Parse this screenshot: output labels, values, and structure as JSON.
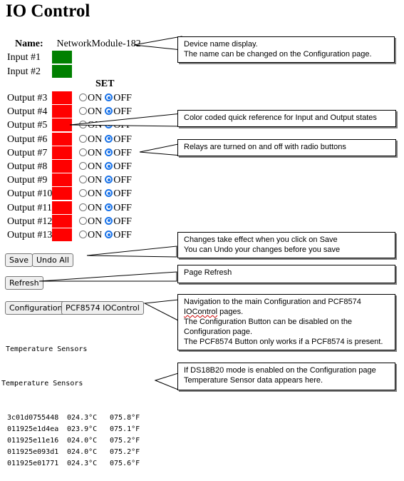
{
  "page": {
    "title": "IO Control"
  },
  "device": {
    "name_label": "Name:",
    "name_value": "NetworkModule-182"
  },
  "inputs": [
    {
      "label": "Input #1",
      "state": "on",
      "color": "#008000"
    },
    {
      "label": "Input #2",
      "state": "on",
      "color": "#008000"
    }
  ],
  "set_header": "SET",
  "radio_labels": {
    "on": "ON",
    "off": "OFF"
  },
  "outputs": [
    {
      "label": "Output #3",
      "state": "off",
      "color": "#ff0000",
      "selected": "OFF"
    },
    {
      "label": "Output #4",
      "state": "off",
      "color": "#ff0000",
      "selected": "OFF"
    },
    {
      "label": "Output #5",
      "state": "off",
      "color": "#ff0000",
      "selected": "OFF"
    },
    {
      "label": "Output #6",
      "state": "off",
      "color": "#ff0000",
      "selected": "OFF"
    },
    {
      "label": "Output #7",
      "state": "off",
      "color": "#ff0000",
      "selected": "OFF"
    },
    {
      "label": "Output #8",
      "state": "off",
      "color": "#ff0000",
      "selected": "OFF"
    },
    {
      "label": "Output #9",
      "state": "off",
      "color": "#ff0000",
      "selected": "OFF"
    },
    {
      "label": "Output #10",
      "state": "off",
      "color": "#ff0000",
      "selected": "OFF"
    },
    {
      "label": "Output #11",
      "state": "off",
      "color": "#ff0000",
      "selected": "OFF"
    },
    {
      "label": "Output #12",
      "state": "off",
      "color": "#ff0000",
      "selected": "OFF"
    },
    {
      "label": "Output #13",
      "state": "off",
      "color": "#ff0000",
      "selected": "OFF"
    }
  ],
  "buttons": {
    "save": "Save",
    "undo_all": "Undo All",
    "refresh": "Refresh",
    "configuration": "Configuration",
    "pcf8574": "PCF8574 IOControl"
  },
  "temperature": {
    "title_1": "Temperature Sensors",
    "title_2": "Temperature Sensors",
    "rows": [
      {
        "id": "3c01d0755448",
        "c": "024.3°C",
        "f": "075.8°F"
      },
      {
        "id": "011925e1d4ea",
        "c": "023.9°C",
        "f": "075.1°F"
      },
      {
        "id": "011925e11e16",
        "c": "024.0°C",
        "f": "075.2°F"
      },
      {
        "id": "011925e093d1",
        "c": "024.0°C",
        "f": "075.2°F"
      },
      {
        "id": "011925e01771",
        "c": "024.3°C",
        "f": "075.6°F"
      }
    ]
  },
  "callouts": {
    "device_name": [
      "Device name display.",
      "The name can be changed on the Configuration page."
    ],
    "color_coded": [
      "Color coded quick reference for Input and Output states"
    ],
    "relays": [
      "Relays are turned on and off with radio buttons"
    ],
    "save_undo": [
      "Changes take effect when you click on Save",
      "You can Undo your changes before you save"
    ],
    "refresh": [
      "Page Refresh"
    ],
    "navigation": [
      "Navigation to the main Configuration and PCF8574",
      "IOControl pages.",
      "The Configuration Button can be disabled on the",
      "Configuration page.",
      "The PCF8574 Button only works if a PCF8574 is present."
    ],
    "ds18b20": [
      "If DS18B20 mode is enabled on the Configuration page",
      "Temperature Sensor data appears here."
    ]
  }
}
